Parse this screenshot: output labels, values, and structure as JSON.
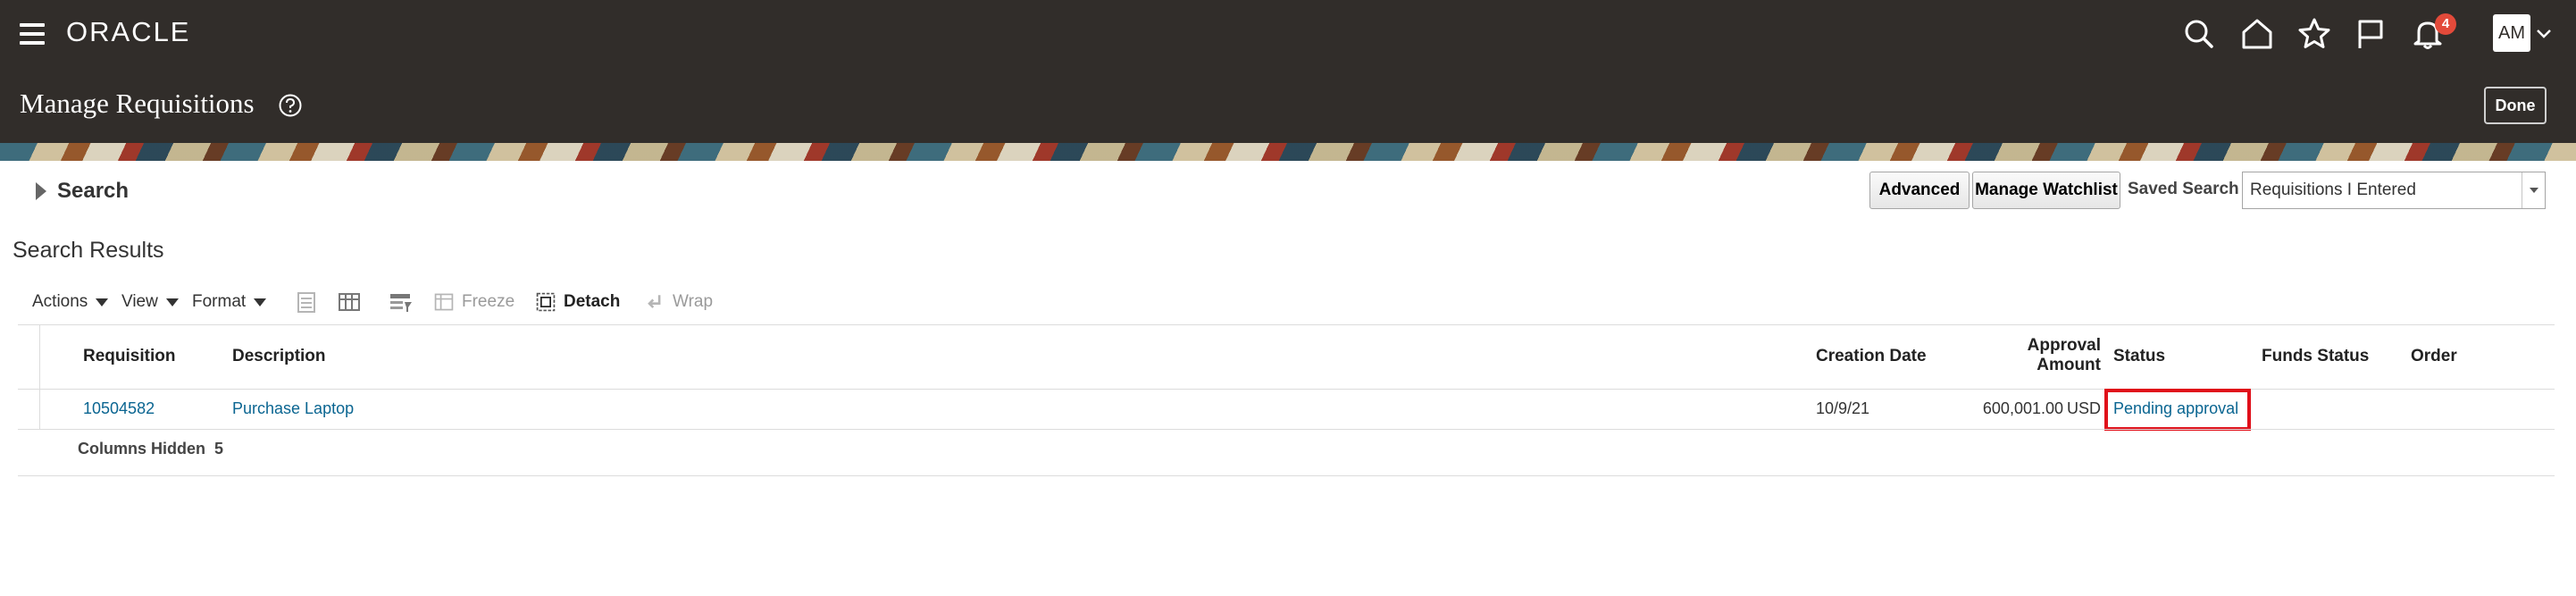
{
  "header": {
    "logo": "ORACLE",
    "page_title": "Manage Requisitions",
    "notification_count": "4",
    "avatar_initials": "AM",
    "done_label": "Done"
  },
  "search": {
    "toggle_label": "Search",
    "advanced_label": "Advanced",
    "watchlist_label": "Manage Watchlist",
    "saved_search_label": "Saved Search",
    "saved_search_value": "Requisitions I Entered"
  },
  "results": {
    "title": "Search Results",
    "toolbar": {
      "actions": "Actions",
      "view": "View",
      "format": "Format",
      "freeze": "Freeze",
      "detach": "Detach",
      "wrap": "Wrap"
    },
    "columns": {
      "requisition": "Requisition",
      "description": "Description",
      "creation_date": "Creation Date",
      "approval_amount_1": "Approval",
      "approval_amount_2": "Amount",
      "status": "Status",
      "funds_status": "Funds Status",
      "order": "Order"
    },
    "rows": [
      {
        "requisition": "10504582",
        "description": "Purchase Laptop",
        "creation_date": "10/9/21",
        "approval_amount": "600,001.00",
        "currency": "USD",
        "status": "Pending approval",
        "funds_status": "",
        "order": ""
      }
    ],
    "columns_hidden_label": "Columns Hidden",
    "columns_hidden_count": "5"
  },
  "colors": {
    "header_bg": "#312d2a",
    "link": "#0a6591",
    "highlight": "#e0101a",
    "badge": "#e34a3a"
  },
  "icons": [
    "menu-icon",
    "search-icon",
    "home-icon",
    "star-icon",
    "flag-icon",
    "bell-icon",
    "chevron-down-icon",
    "help-icon"
  ]
}
